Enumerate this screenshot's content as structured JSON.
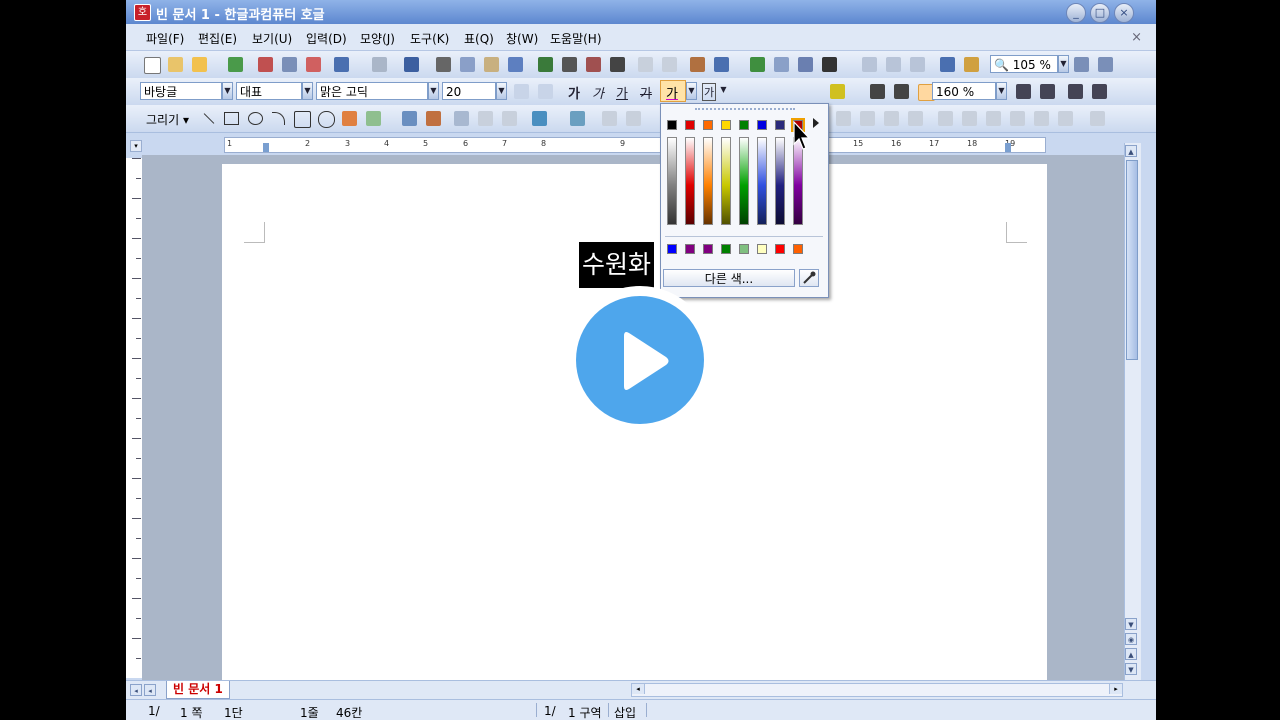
{
  "window": {
    "title": "빈 문서 1 - 한글과컴퓨터 호글",
    "app_icon_glyph": "호",
    "controls": [
      "_",
      "□",
      "×"
    ]
  },
  "menu": {
    "items": [
      "파일(F)",
      "편집(E)",
      "보기(U)",
      "입력(D)",
      "모양(J)",
      "도구(K)",
      "표(Q)",
      "창(W)",
      "도움말(H)"
    ],
    "close": "×"
  },
  "toolbar1": {
    "zoom": "105 %"
  },
  "format_toolbar": {
    "style": "바탕글",
    "lang": "대표",
    "font": "맑은 고딕",
    "size": "20",
    "bold": "가",
    "italic": "가",
    "underline": "가",
    "strike": "가",
    "char_color": "가",
    "shade": "가",
    "line_spacing": "160 %"
  },
  "draw_toolbar": {
    "label": "그리기"
  },
  "ruler": {
    "numbers": [
      "1",
      "2",
      "3",
      "4",
      "5",
      "6",
      "7",
      "8",
      "9",
      "15",
      "16",
      "17",
      "18",
      "19"
    ]
  },
  "document": {
    "selected_text": "수원화"
  },
  "color_palette": {
    "top_colors": [
      "#000000",
      "#e00000",
      "#ff6a00",
      "#ffd800",
      "#008000",
      "#0000e0",
      "#2a2a7a",
      "#b00000"
    ],
    "column_colors": [
      "#808080",
      "#e00000",
      "#ff8000",
      "#c8c800",
      "#00a000",
      "#3050e0",
      "#202080",
      "#8000a0"
    ],
    "recent_colors": [
      "#0000ff",
      "#800080",
      "#800080",
      "#008000",
      "#80c080",
      "#ffffc0",
      "#ff0000",
      "#ff6000"
    ],
    "more_colors_label": "다른 색..."
  },
  "tabs": {
    "document_tab": "빈 문서 1"
  },
  "statusbar": {
    "page": "1/",
    "page_of": "1 쪽",
    "section": "1단",
    "line": "1줄",
    "column": "46칸",
    "zone_page": "1/",
    "zone": "1 구역",
    "mode": "삽입"
  }
}
